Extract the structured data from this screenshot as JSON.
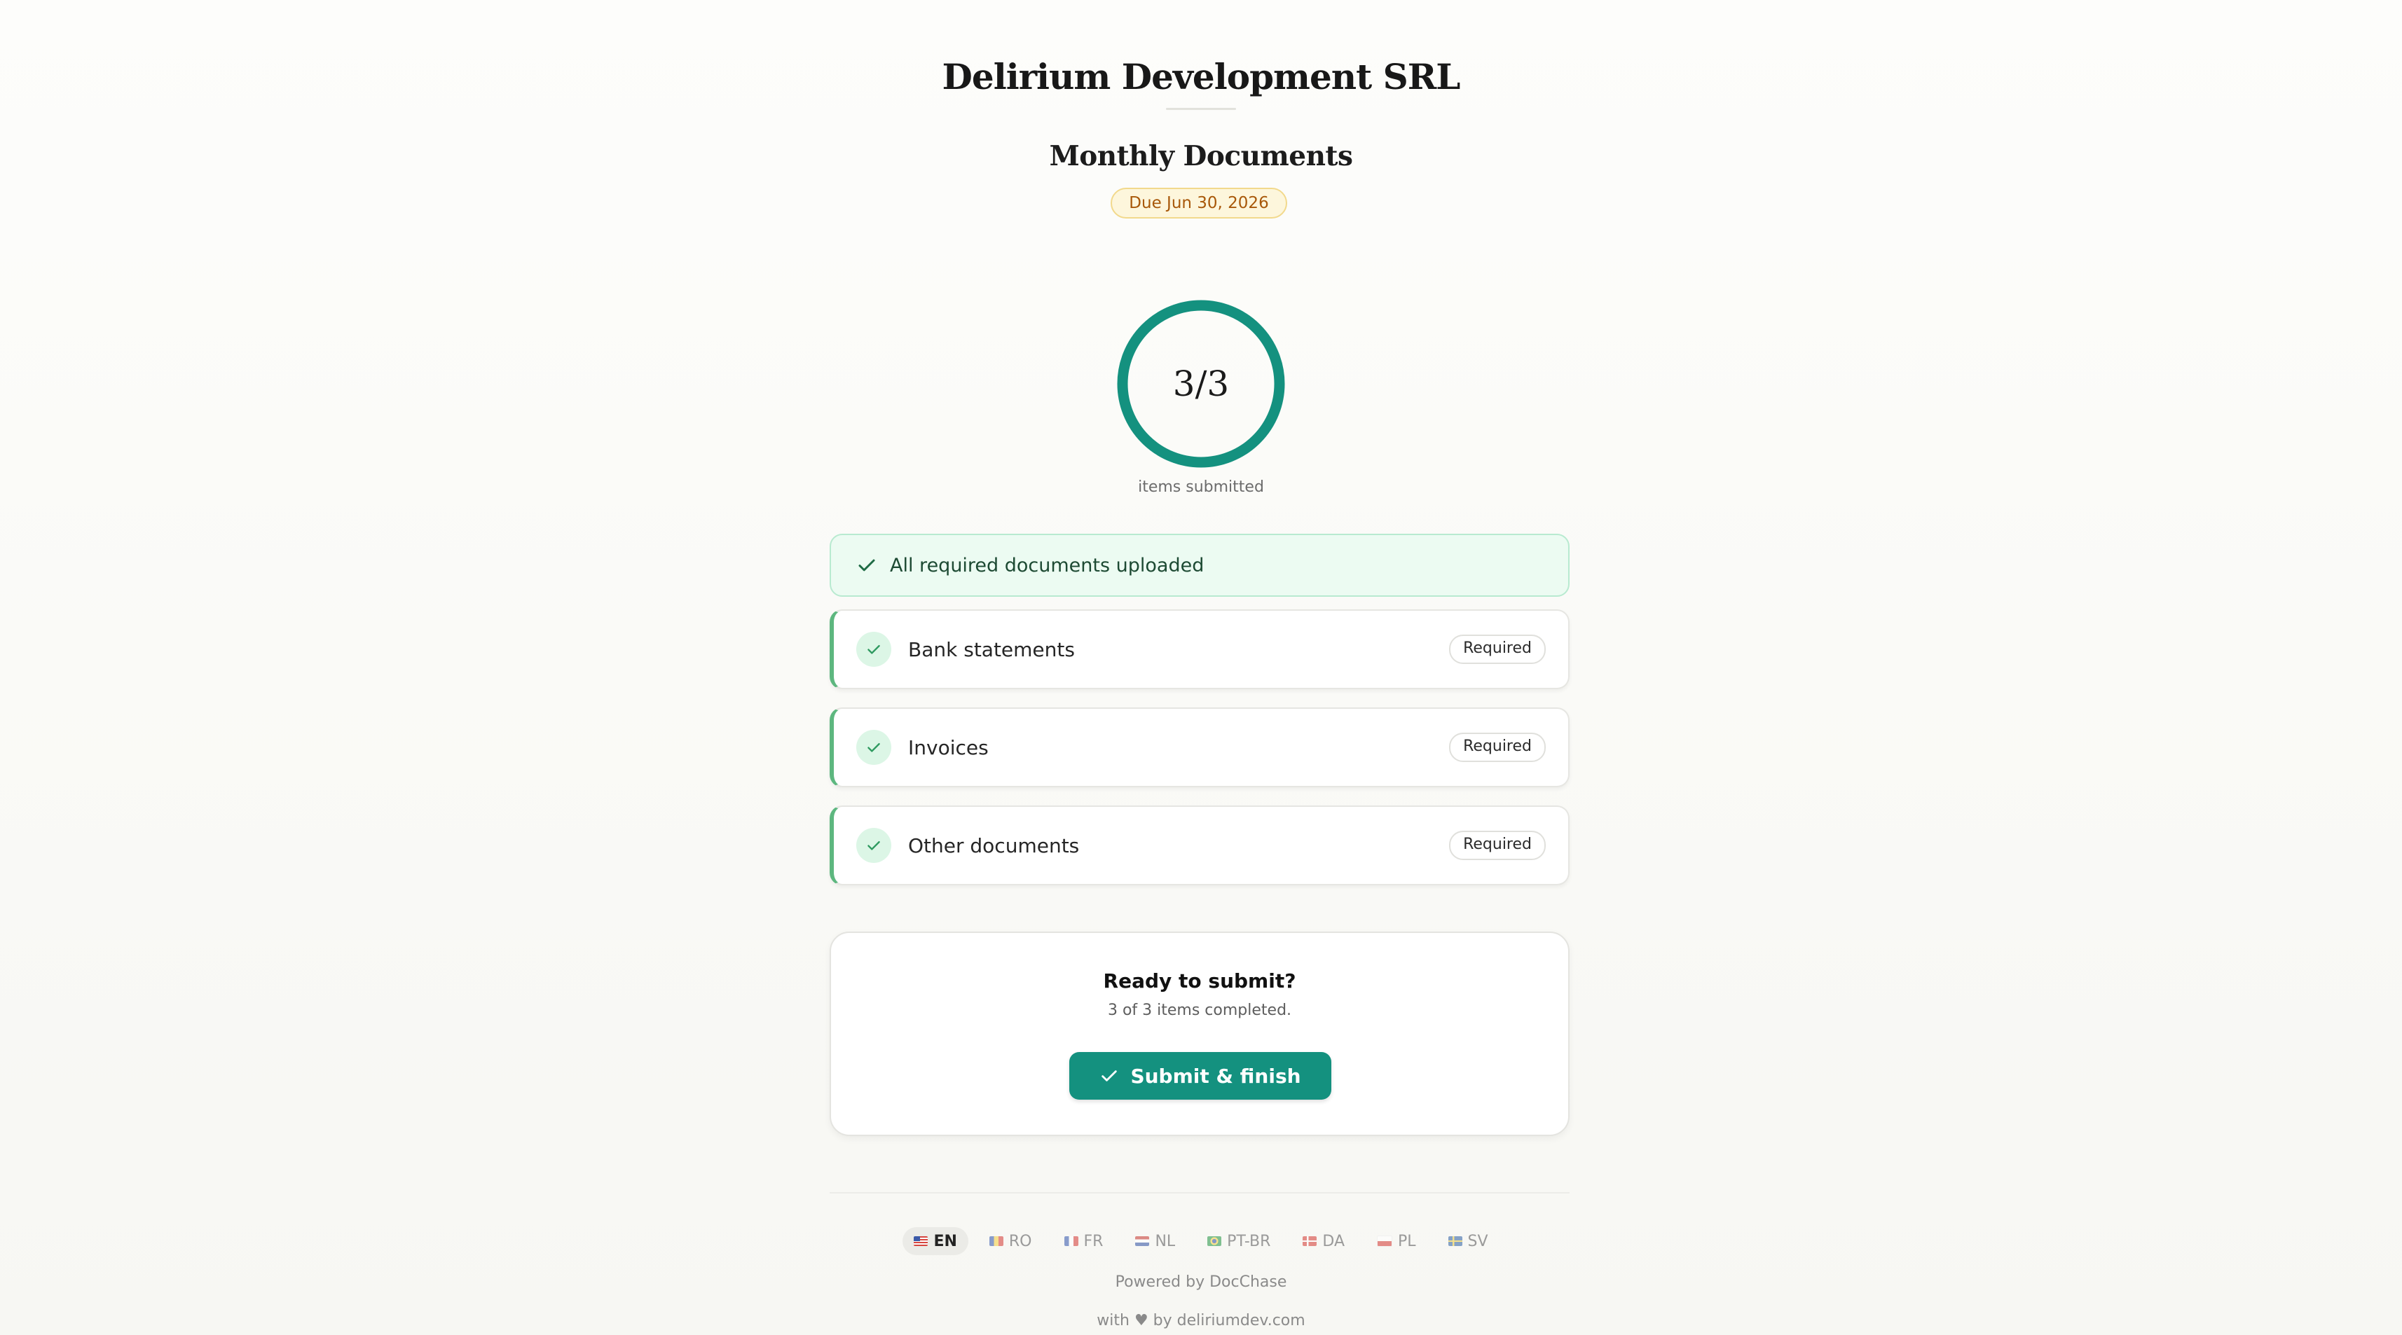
{
  "header": {
    "company": "Delirium Development SRL",
    "title": "Monthly Documents",
    "due": "Due Jun 30, 2026"
  },
  "progress": {
    "label": "3/3",
    "caption": "items submitted",
    "completed": 3,
    "total": 3
  },
  "alert": {
    "text": "All required documents uploaded",
    "icon": "check-icon"
  },
  "items": [
    {
      "label": "Bank statements",
      "badge": "Required",
      "icon": "check-icon"
    },
    {
      "label": "Invoices",
      "badge": "Required",
      "icon": "check-icon"
    },
    {
      "label": "Other documents",
      "badge": "Required",
      "icon": "check-icon"
    }
  ],
  "submit_card": {
    "title": "Ready to submit?",
    "subtitle": "3 of 3 items completed.",
    "button": "Submit & finish"
  },
  "languages": [
    {
      "code": "EN",
      "active": true
    },
    {
      "code": "RO",
      "active": false
    },
    {
      "code": "FR",
      "active": false
    },
    {
      "code": "NL",
      "active": false
    },
    {
      "code": "PT-BR",
      "active": false
    },
    {
      "code": "DA",
      "active": false
    },
    {
      "code": "PL",
      "active": false
    },
    {
      "code": "SV",
      "active": false
    }
  ],
  "footer": {
    "powered": "Powered by DocChase",
    "madewith": "with ♥ by deliriumdev.com"
  },
  "colors": {
    "accent": "#14917f",
    "success_border": "#5db77f",
    "due_text": "#a8580a"
  }
}
